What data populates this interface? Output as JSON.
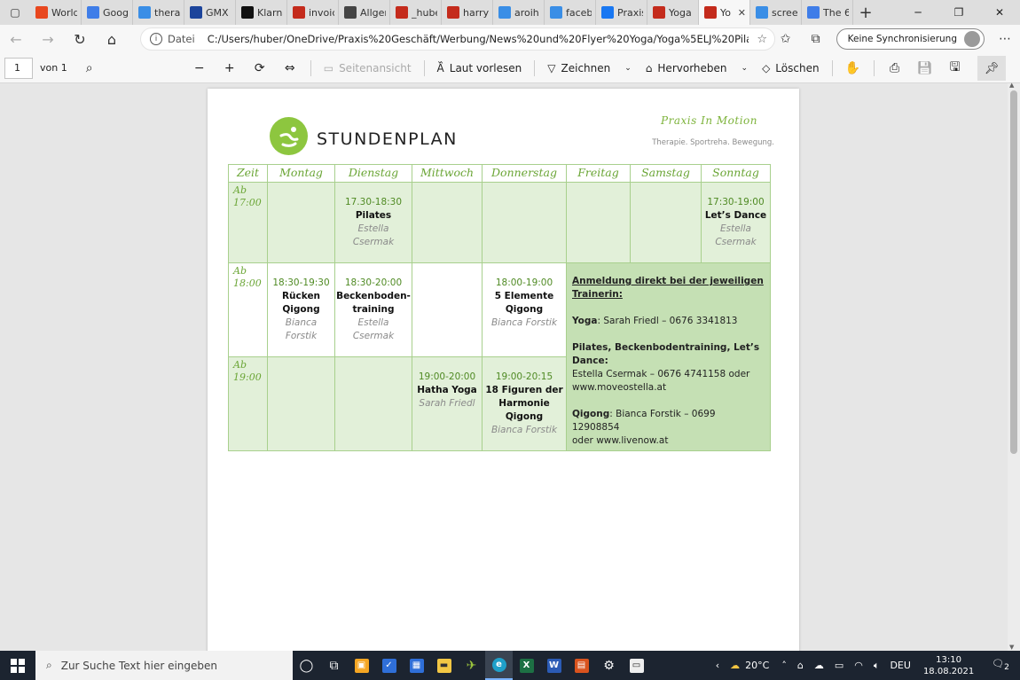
{
  "browser": {
    "tabs": [
      {
        "label": "World",
        "icon": "four-icon",
        "color": "#e8471e"
      },
      {
        "label": "Googl",
        "icon": "calendar-icon",
        "color": "#3f7de8"
      },
      {
        "label": "therap",
        "icon": "bing-icon",
        "color": "#3a8ee6"
      },
      {
        "label": "GMX F",
        "icon": "gmx-icon",
        "color": "#1c449b"
      },
      {
        "label": "Klarna",
        "icon": "klarna-icon",
        "color": "#111111"
      },
      {
        "label": "invoic",
        "icon": "pdf-icon",
        "color": "#c42b1c"
      },
      {
        "label": "Allgen",
        "icon": "tool-icon",
        "color": "#444444"
      },
      {
        "label": "_hube",
        "icon": "pdf-icon",
        "color": "#c42b1c"
      },
      {
        "label": "harry",
        "icon": "pdf-icon",
        "color": "#c42b1c"
      },
      {
        "label": "aroih",
        "icon": "bing-icon",
        "color": "#3a8ee6"
      },
      {
        "label": "faceb",
        "icon": "bing-icon",
        "color": "#3a8ee6"
      },
      {
        "label": "Praxis",
        "icon": "facebook-icon",
        "color": "#1877f2"
      },
      {
        "label": "Yoga",
        "icon": "pdf-icon",
        "color": "#c42b1c"
      },
      {
        "label": "Yo",
        "icon": "pdf-icon",
        "color": "#c42b1c",
        "active": true
      },
      {
        "label": "screen",
        "icon": "bing-icon",
        "color": "#3a8ee6"
      },
      {
        "label": "The 6",
        "icon": "check-icon",
        "color": "#3f7de8"
      }
    ],
    "address": {
      "scheme": "Datei",
      "url": "C:/Users/huber/OneDrive/Praxis%20Geschäft/Werbung/News%20und%20Flyer%20Yoga/Yoga%5ELJ%20Pilates%5..."
    },
    "sync_label": "Keine Synchronisierung"
  },
  "pdf_toolbar": {
    "page_number": "1",
    "page_of": "von 1",
    "page_view": "Seitenansicht",
    "read_aloud": "Laut vorlesen",
    "draw": "Zeichnen",
    "highlight": "Hervorheben",
    "erase": "Löschen"
  },
  "document": {
    "title": "STUNDENPLAN",
    "brand": "Praxis In Motion",
    "tagline": "Therapie. Sportreha. Bewegung.",
    "headers": [
      "Zeit",
      "Montag",
      "Dienstag",
      "Mittwoch",
      "Donnerstag",
      "Freitag",
      "Samstag",
      "Sonntag"
    ],
    "rows": [
      {
        "time_a": "Ab",
        "time_b": "17:00",
        "dienstag": {
          "time": "17.30-18:30",
          "course": "Pilates",
          "trainer_a": "Estella",
          "trainer_b": "Csermak"
        },
        "sonntag": {
          "time": "17:30-19:00",
          "course": "Let’s Dance",
          "trainer_a": "Estella",
          "trainer_b": "Csermak"
        }
      },
      {
        "time_a": "Ab",
        "time_b": "18:00",
        "montag": {
          "time": "18:30-19:30",
          "course_a": "Rücken",
          "course_b": "Qigong",
          "trainer_a": "Bianca",
          "trainer_b": "Forstik"
        },
        "dienstag": {
          "time": "18:30-20:00",
          "course_a": "Beckenboden-",
          "course_b": "training",
          "trainer_a": "Estella",
          "trainer_b": "Csermak"
        },
        "donnerstag": {
          "time": "18:00-19:00",
          "course_a": "5 Elemente",
          "course_b": "Qigong",
          "trainer": "Bianca Forstik"
        }
      },
      {
        "time_a": "Ab",
        "time_b": "19:00",
        "mittwoch": {
          "time": "19:00-20:00",
          "course": "Hatha Yoga",
          "trainer": "Sarah Friedl"
        },
        "donnerstag": {
          "time": "19:00-20:15",
          "course_a": "18 Figuren der",
          "course_b": "Harmonie",
          "course_c": "Qigong",
          "trainer": "Bianca Forstik"
        }
      }
    ],
    "info": {
      "heading_a": "Anmeldung direkt bei der jeweiligen",
      "heading_b": "Trainerin:",
      "yoga_label": "Yoga",
      "yoga_text": ": Sarah Friedl – 0676 3341813",
      "pilates_label": "Pilates, Beckenbodentraining, Let’s Dance:",
      "pilates_text_a": "Estella Csermak – 0676 4741158 oder",
      "pilates_text_b": "www.moveostella.at",
      "qigong_label": "Qigong",
      "qigong_text_a": ": Bianca Forstik – 0699 12908854",
      "qigong_text_b": "oder www.livenow.at"
    }
  },
  "taskbar": {
    "search_placeholder": "Zur Suche Text hier eingeben",
    "weather": "20°C",
    "language": "DEU",
    "time": "13:10",
    "date": "18.08.2021",
    "notifications": "2"
  },
  "colors": {
    "accent_green": "#8dc63f",
    "header_green": "#6aa535",
    "light_green_cell": "#e2f0d9",
    "info_green": "#c5e0b4"
  }
}
